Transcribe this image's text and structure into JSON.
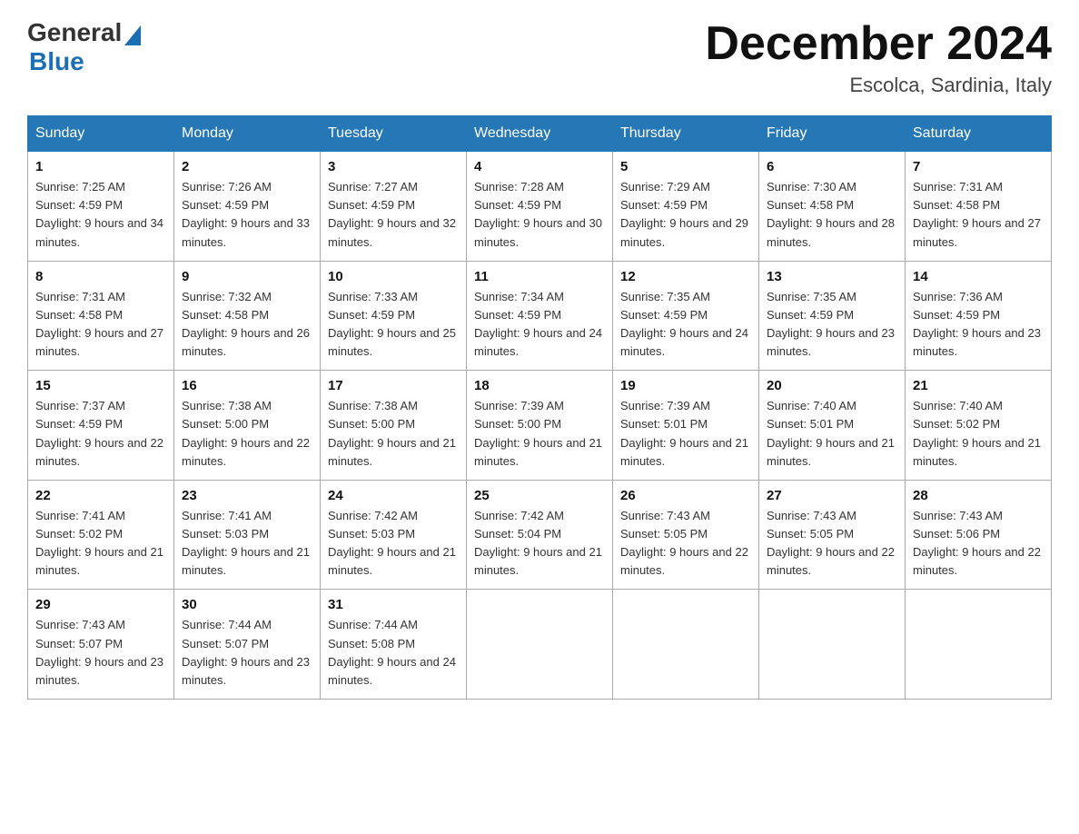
{
  "logo": {
    "general": "General",
    "blue": "Blue"
  },
  "title": "December 2024",
  "location": "Escolca, Sardinia, Italy",
  "weekdays": [
    "Sunday",
    "Monday",
    "Tuesday",
    "Wednesday",
    "Thursday",
    "Friday",
    "Saturday"
  ],
  "weeks": [
    [
      {
        "day": "1",
        "sunrise": "7:25 AM",
        "sunset": "4:59 PM",
        "daylight": "9 hours and 34 minutes."
      },
      {
        "day": "2",
        "sunrise": "7:26 AM",
        "sunset": "4:59 PM",
        "daylight": "9 hours and 33 minutes."
      },
      {
        "day": "3",
        "sunrise": "7:27 AM",
        "sunset": "4:59 PM",
        "daylight": "9 hours and 32 minutes."
      },
      {
        "day": "4",
        "sunrise": "7:28 AM",
        "sunset": "4:59 PM",
        "daylight": "9 hours and 30 minutes."
      },
      {
        "day": "5",
        "sunrise": "7:29 AM",
        "sunset": "4:59 PM",
        "daylight": "9 hours and 29 minutes."
      },
      {
        "day": "6",
        "sunrise": "7:30 AM",
        "sunset": "4:58 PM",
        "daylight": "9 hours and 28 minutes."
      },
      {
        "day": "7",
        "sunrise": "7:31 AM",
        "sunset": "4:58 PM",
        "daylight": "9 hours and 27 minutes."
      }
    ],
    [
      {
        "day": "8",
        "sunrise": "7:31 AM",
        "sunset": "4:58 PM",
        "daylight": "9 hours and 27 minutes."
      },
      {
        "day": "9",
        "sunrise": "7:32 AM",
        "sunset": "4:58 PM",
        "daylight": "9 hours and 26 minutes."
      },
      {
        "day": "10",
        "sunrise": "7:33 AM",
        "sunset": "4:59 PM",
        "daylight": "9 hours and 25 minutes."
      },
      {
        "day": "11",
        "sunrise": "7:34 AM",
        "sunset": "4:59 PM",
        "daylight": "9 hours and 24 minutes."
      },
      {
        "day": "12",
        "sunrise": "7:35 AM",
        "sunset": "4:59 PM",
        "daylight": "9 hours and 24 minutes."
      },
      {
        "day": "13",
        "sunrise": "7:35 AM",
        "sunset": "4:59 PM",
        "daylight": "9 hours and 23 minutes."
      },
      {
        "day": "14",
        "sunrise": "7:36 AM",
        "sunset": "4:59 PM",
        "daylight": "9 hours and 23 minutes."
      }
    ],
    [
      {
        "day": "15",
        "sunrise": "7:37 AM",
        "sunset": "4:59 PM",
        "daylight": "9 hours and 22 minutes."
      },
      {
        "day": "16",
        "sunrise": "7:38 AM",
        "sunset": "5:00 PM",
        "daylight": "9 hours and 22 minutes."
      },
      {
        "day": "17",
        "sunrise": "7:38 AM",
        "sunset": "5:00 PM",
        "daylight": "9 hours and 21 minutes."
      },
      {
        "day": "18",
        "sunrise": "7:39 AM",
        "sunset": "5:00 PM",
        "daylight": "9 hours and 21 minutes."
      },
      {
        "day": "19",
        "sunrise": "7:39 AM",
        "sunset": "5:01 PM",
        "daylight": "9 hours and 21 minutes."
      },
      {
        "day": "20",
        "sunrise": "7:40 AM",
        "sunset": "5:01 PM",
        "daylight": "9 hours and 21 minutes."
      },
      {
        "day": "21",
        "sunrise": "7:40 AM",
        "sunset": "5:02 PM",
        "daylight": "9 hours and 21 minutes."
      }
    ],
    [
      {
        "day": "22",
        "sunrise": "7:41 AM",
        "sunset": "5:02 PM",
        "daylight": "9 hours and 21 minutes."
      },
      {
        "day": "23",
        "sunrise": "7:41 AM",
        "sunset": "5:03 PM",
        "daylight": "9 hours and 21 minutes."
      },
      {
        "day": "24",
        "sunrise": "7:42 AM",
        "sunset": "5:03 PM",
        "daylight": "9 hours and 21 minutes."
      },
      {
        "day": "25",
        "sunrise": "7:42 AM",
        "sunset": "5:04 PM",
        "daylight": "9 hours and 21 minutes."
      },
      {
        "day": "26",
        "sunrise": "7:43 AM",
        "sunset": "5:05 PM",
        "daylight": "9 hours and 22 minutes."
      },
      {
        "day": "27",
        "sunrise": "7:43 AM",
        "sunset": "5:05 PM",
        "daylight": "9 hours and 22 minutes."
      },
      {
        "day": "28",
        "sunrise": "7:43 AM",
        "sunset": "5:06 PM",
        "daylight": "9 hours and 22 minutes."
      }
    ],
    [
      {
        "day": "29",
        "sunrise": "7:43 AM",
        "sunset": "5:07 PM",
        "daylight": "9 hours and 23 minutes."
      },
      {
        "day": "30",
        "sunrise": "7:44 AM",
        "sunset": "5:07 PM",
        "daylight": "9 hours and 23 minutes."
      },
      {
        "day": "31",
        "sunrise": "7:44 AM",
        "sunset": "5:08 PM",
        "daylight": "9 hours and 24 minutes."
      },
      null,
      null,
      null,
      null
    ]
  ]
}
